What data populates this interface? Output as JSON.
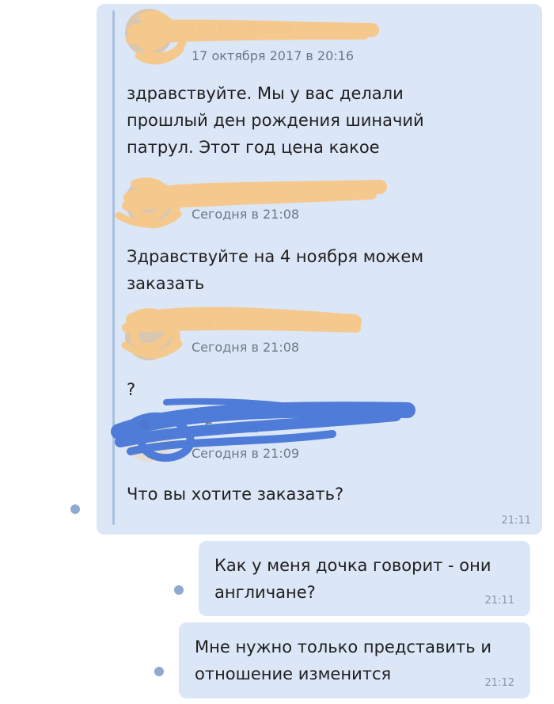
{
  "forwarded": [
    {
      "name": "Н... Ел...йнова",
      "date": "17 октября 2017 в 20:16",
      "text": "здравствуйте. Мы у вас делали прошлый ден рождения шиначий патрул. Этот год цена какое"
    },
    {
      "name": "Н...",
      "date": "Сегодня в 21:08",
      "text": "Здравствуйте на 4 ноября можем заказать"
    },
    {
      "name": "...а",
      "date": "Сегодня в 21:08",
      "text": "?"
    },
    {
      "name": "...Е...кова",
      "date": "Сегодня в 21:09",
      "text": "Что вы хотите заказать?"
    }
  ],
  "forward_time": "21:11",
  "messages": [
    {
      "text": "Как у меня дочка говорит - они англичане?",
      "time": "21:11"
    },
    {
      "text": "Мне нужно только представить и отношение изменится",
      "time": "21:12"
    }
  ],
  "colors": {
    "bubble": "#dbe6f7",
    "unread_dot": "#8fa9cf",
    "redaction_beige": "#f6c98b",
    "redaction_blue": "#4a79d8"
  }
}
